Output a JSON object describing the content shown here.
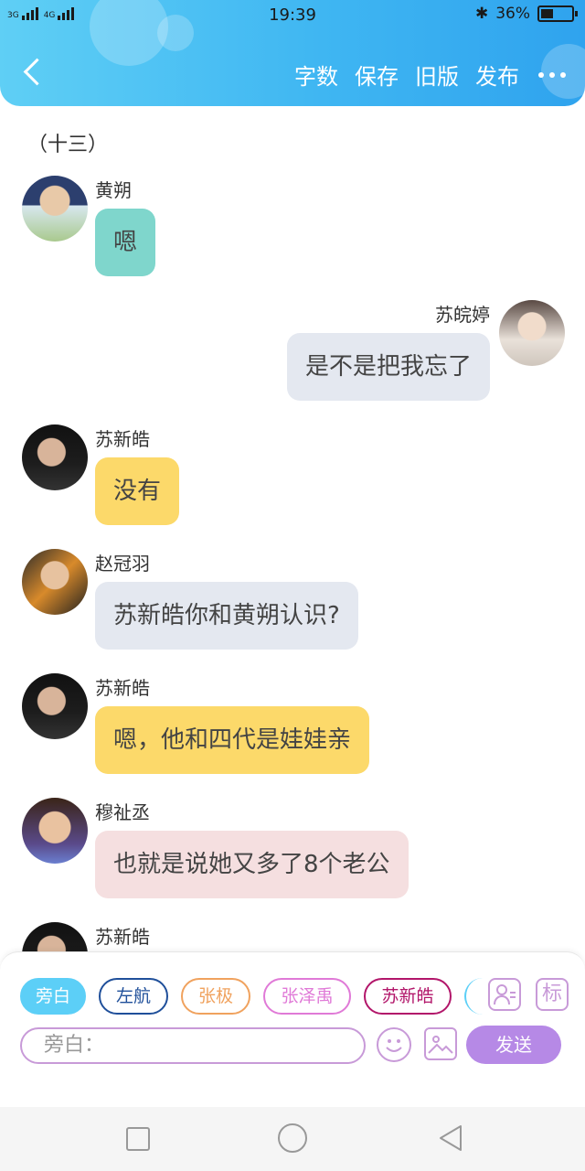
{
  "status": {
    "network": "3G",
    "network2": "4G",
    "time": "19:39",
    "battery": "36%",
    "battery_level": 0.36
  },
  "nav": {
    "back_icon": "chevron-left-icon",
    "word_count": "字数",
    "save": "保存",
    "old_version": "旧版",
    "publish": "发布",
    "more_icon": "more-icon"
  },
  "chapter": "（十三）",
  "messages": [
    {
      "name": "黄朔",
      "text": "嗯",
      "side": "left",
      "color": "#7fd6cc"
    },
    {
      "name": "苏皖婷",
      "text": "是不是把我忘了",
      "side": "right",
      "color": "#e4e8f0"
    },
    {
      "name": "苏新皓",
      "text": "没有",
      "side": "left",
      "color": "#fcd96a"
    },
    {
      "name": "赵冠羽",
      "text": "苏新皓你和黄朔认识?",
      "side": "left",
      "color": "#e4e8f0"
    },
    {
      "name": "苏新皓",
      "text": "嗯，他和四代是娃娃亲",
      "side": "left",
      "color": "#fcd96a"
    },
    {
      "name": "穆祉丞",
      "text": "也就是说她又多了8个老公",
      "side": "left",
      "color": "#f5dfe0"
    },
    {
      "name": "苏新皓",
      "text": "",
      "side": "left",
      "color": "#fcd96a"
    }
  ],
  "composer": {
    "chips": [
      {
        "label": "旁白",
        "color": "#5ccff7",
        "active": true
      },
      {
        "label": "左航",
        "color": "#1f4f9a"
      },
      {
        "label": "张极",
        "color": "#f0a25e"
      },
      {
        "label": "张泽禹",
        "color": "#e07ad7"
      },
      {
        "label": "苏新皓",
        "color": "#b2166a"
      }
    ],
    "person_icon": "person-card-icon",
    "tag_label": "标",
    "placeholder": "旁白：",
    "emoji_icon": "emoji-icon",
    "image_icon": "image-icon",
    "send": "发送"
  }
}
